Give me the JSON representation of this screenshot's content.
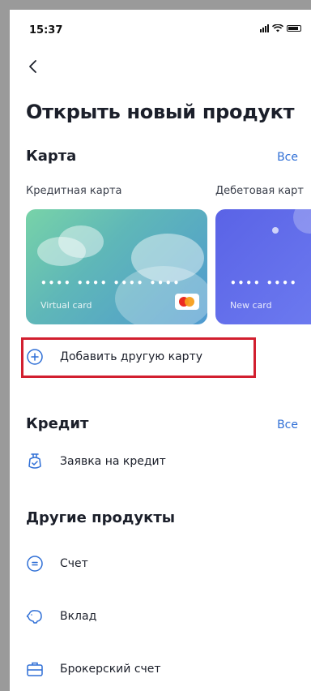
{
  "status_bar": {
    "time": "15:37"
  },
  "header": {
    "title": "Открыть новый продукт"
  },
  "cards_section": {
    "title": "Карта",
    "all_label": "Все",
    "cards": [
      {
        "label": "Кредитная карта",
        "number_mask": "•••• •••• •••• ••••",
        "caption": "Virtual card"
      },
      {
        "label": "Дебетовая карт",
        "number_mask": "•••• ••••",
        "caption": "New card"
      }
    ],
    "add_card_label": "Добавить другую карту"
  },
  "credit_section": {
    "title": "Кредит",
    "all_label": "Все",
    "items": [
      {
        "label": "Заявка на кредит",
        "icon": "wallet-clock-icon"
      }
    ]
  },
  "other_section": {
    "title": "Другие продукты",
    "items": [
      {
        "label": "Счет",
        "icon": "account-icon"
      },
      {
        "label": "Вклад",
        "icon": "piggy-bank-icon"
      },
      {
        "label": "Брокерский счет",
        "icon": "briefcase-icon"
      }
    ]
  },
  "colors": {
    "accent": "#2f6fd6",
    "highlight": "#d21f2f",
    "text": "#1b1f2a"
  }
}
